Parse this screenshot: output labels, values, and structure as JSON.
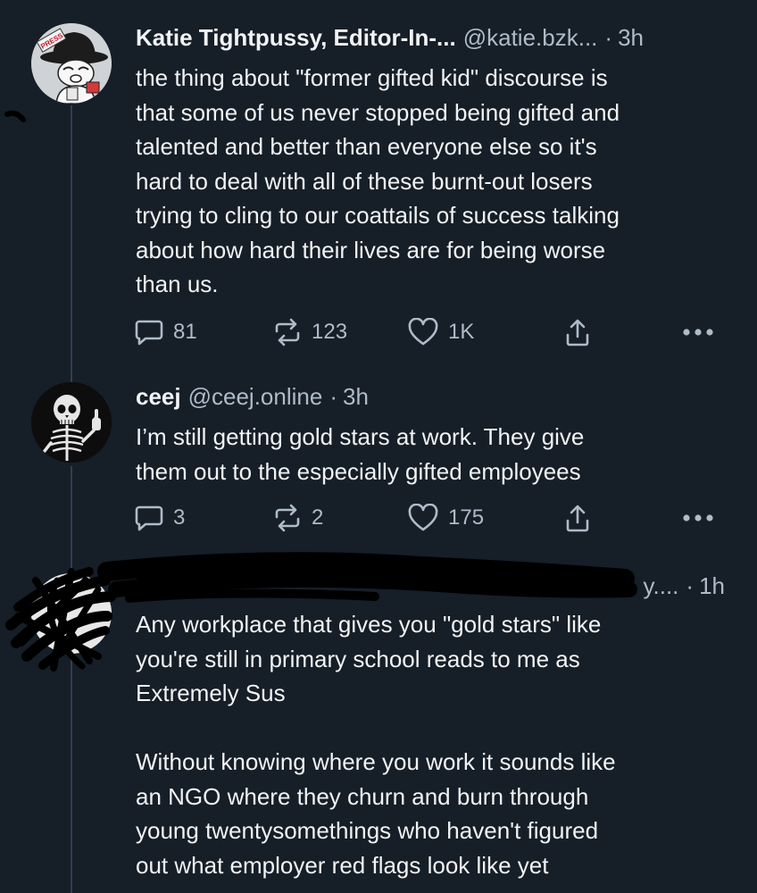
{
  "posts": [
    {
      "display_name": "Katie Tightpussy, Editor-In-...",
      "handle": "@katie.bzk...",
      "time": "3h",
      "avatar_badge": "PRESS",
      "text": "the thing about \"former gifted kid\" discourse is\nthat some of us never stopped being gifted and\ntalented and better than everyone else so it's\nhard to deal with all of these burnt-out losers\ntrying to cling to our coattails of success talking\nabout how hard their lives are for being worse\nthan us.",
      "replies": "81",
      "reposts": "123",
      "likes": "1K"
    },
    {
      "display_name": "ceej",
      "handle": "@ceej.online",
      "time": "3h",
      "text": "I’m still getting gold stars at work. They give\nthem out to the especially gifted employees",
      "replies": "3",
      "reposts": "2",
      "likes": "175"
    },
    {
      "handle_visible_fragment": "y....",
      "time": "1h",
      "text": "Any workplace that gives you \"gold stars\" like\nyou're still in primary school reads to me as\nExtremely Sus\n\nWithout knowing where you work it sounds like\nan NGO where they churn and burn through\nyoung twentysomethings who haven't figured\nout what employer red flags look like yet"
    }
  ],
  "icons": {
    "reply": "speech-bubble-icon",
    "repost": "repost-arrows-icon",
    "like": "heart-icon",
    "share": "share-upload-icon",
    "more": "ellipsis-icon"
  },
  "colors": {
    "background": "#161e27",
    "text": "#f1f3f5",
    "muted": "#aebbc9",
    "thread_line": "#2e4052"
  }
}
